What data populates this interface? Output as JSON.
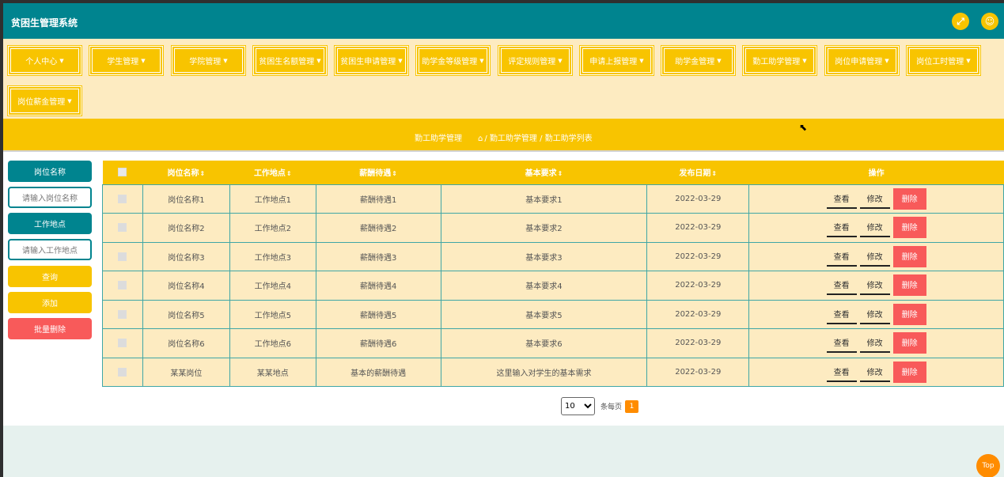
{
  "header": {
    "title": "贫困生管理系统",
    "icons": [
      "fullscreen-icon",
      "user-icon"
    ]
  },
  "nav": {
    "items": [
      {
        "label": "个人中心"
      },
      {
        "label": "学生管理"
      },
      {
        "label": "学院管理"
      },
      {
        "label": "贫困生名额管理"
      },
      {
        "label": "贫困生申请管理"
      },
      {
        "label": "助学金等级管理"
      },
      {
        "label": "评定规则管理"
      },
      {
        "label": "申请上报管理"
      },
      {
        "label": "助学金管理"
      },
      {
        "label": "勤工助学管理"
      },
      {
        "label": "岗位申请管理"
      },
      {
        "label": "岗位工时管理"
      },
      {
        "label": "岗位薪金管理"
      }
    ]
  },
  "breadcrumb": {
    "title": "勤工助学管理",
    "path": "/ 勤工助学管理 / 勤工助学列表"
  },
  "search": {
    "field1_label": "岗位名称",
    "field1_placeholder": "请输入岗位名称",
    "field2_label": "工作地点",
    "field2_placeholder": "请输入工作地点",
    "query_label": "查询",
    "add_label": "添加",
    "batch_delete_label": "批量删除"
  },
  "table": {
    "headers": [
      "岗位名称",
      "工作地点",
      "薪酬待遇",
      "基本要求",
      "发布日期",
      "操作"
    ],
    "rows": [
      {
        "name": "岗位名称1",
        "place": "工作地点1",
        "pay": "薪酬待遇1",
        "req": "基本要求1",
        "date": "2022-03-29"
      },
      {
        "name": "岗位名称2",
        "place": "工作地点2",
        "pay": "薪酬待遇2",
        "req": "基本要求2",
        "date": "2022-03-29"
      },
      {
        "name": "岗位名称3",
        "place": "工作地点3",
        "pay": "薪酬待遇3",
        "req": "基本要求3",
        "date": "2022-03-29"
      },
      {
        "name": "岗位名称4",
        "place": "工作地点4",
        "pay": "薪酬待遇4",
        "req": "基本要求4",
        "date": "2022-03-29"
      },
      {
        "name": "岗位名称5",
        "place": "工作地点5",
        "pay": "薪酬待遇5",
        "req": "基本要求5",
        "date": "2022-03-29"
      },
      {
        "name": "岗位名称6",
        "place": "工作地点6",
        "pay": "薪酬待遇6",
        "req": "基本要求6",
        "date": "2022-03-29"
      },
      {
        "name": "某某岗位",
        "place": "某某地点",
        "pay": "基本的薪酬待遇",
        "req": "这里输入对学生的基本需求",
        "date": "2022-03-29"
      }
    ],
    "actions": {
      "view": "查看",
      "edit": "修改",
      "delete": "删除"
    }
  },
  "pagination": {
    "page_size": "10",
    "per_page_label": "条每页",
    "current_page": "1"
  },
  "top_button": "Top",
  "colors": {
    "teal": "#00848f",
    "yellow": "#f8c400",
    "cream": "#fdebc1",
    "red": "#f85a5a",
    "orange": "#ff8c00"
  }
}
